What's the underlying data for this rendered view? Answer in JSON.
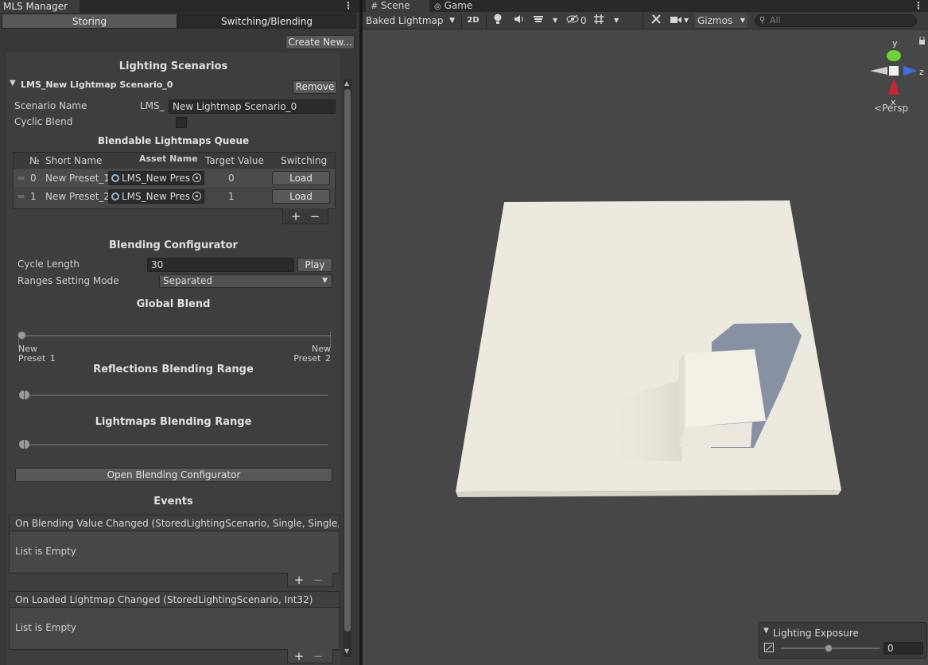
{
  "left_panel": {
    "title": "MLS Manager",
    "segments": [
      "Storing",
      "Switching/Blending"
    ],
    "create_new": "Create New...",
    "lighting_scenarios_header": "Lighting Scenarios",
    "scenario": {
      "foldout_title": "LMS_New Lightmap Scenario_0",
      "remove": "Remove",
      "name_label": "Scenario Name",
      "name_prefix": "LMS_",
      "name_value": "New Lightmap Scenario_0",
      "cyclic_label": "Cyclic Blend"
    },
    "queue": {
      "header": "Blendable Lightmaps Queue",
      "columns": [
        "№",
        "Short Name",
        "Asset Name",
        "Target Value",
        "Switching"
      ],
      "rows": [
        {
          "no": "0",
          "short": "New Preset_1",
          "asset": "LMS_New Pres",
          "target": "0",
          "action": "Load"
        },
        {
          "no": "1",
          "short": "New Preset_2",
          "asset": "LMS_New Pres",
          "target": "1",
          "action": "Load"
        }
      ],
      "add": "+",
      "remove": "−"
    },
    "blending": {
      "header": "Blending Configurator",
      "cycle_label": "Cycle Length",
      "cycle_value": "30",
      "play": "Play",
      "mode_label": "Ranges Setting Mode",
      "mode_value": "Separated",
      "global_blend_header": "Global Blend",
      "global_blend_value": 0,
      "left_label": "New\nPreset_1",
      "right_label": "New\nPreset_2",
      "reflections_header": "Reflections Blending Range",
      "lightmaps_header": "Lightmaps Blending Range",
      "open_configurator": "Open Blending Configurator"
    },
    "events": {
      "header": "Events",
      "list": [
        {
          "title": "On Blending Value Changed (StoredLightingScenario, Single, Single, Sir",
          "empty": "List is Empty"
        },
        {
          "title": "On Loaded Lightmap Changed (StoredLightingScenario, Int32)",
          "empty": "List is Empty"
        }
      ],
      "add": "+",
      "remove": "−"
    }
  },
  "scene": {
    "tabs": [
      "Scene",
      "Game"
    ],
    "draw_mode": "Baked Lightmap",
    "mode_2d": "2D",
    "hidden_count": "0",
    "gizmos": "Gizmos",
    "search_placeholder": "All",
    "axis_labels": {
      "y": "y",
      "z": "z",
      "x": "x"
    },
    "projection": "Persp",
    "exposure": {
      "title": "Lighting Exposure",
      "value": "0"
    }
  },
  "colors": {
    "panel_bg": "#383838",
    "viewport_bg": "#474747",
    "floor": "#ece9df",
    "cube_top": "#f3f0e6",
    "shadow": "#8890a4",
    "gizmo_y": "#6ed339",
    "gizmo_z": "#3a6fdf",
    "gizmo_x": "#c8262a"
  }
}
